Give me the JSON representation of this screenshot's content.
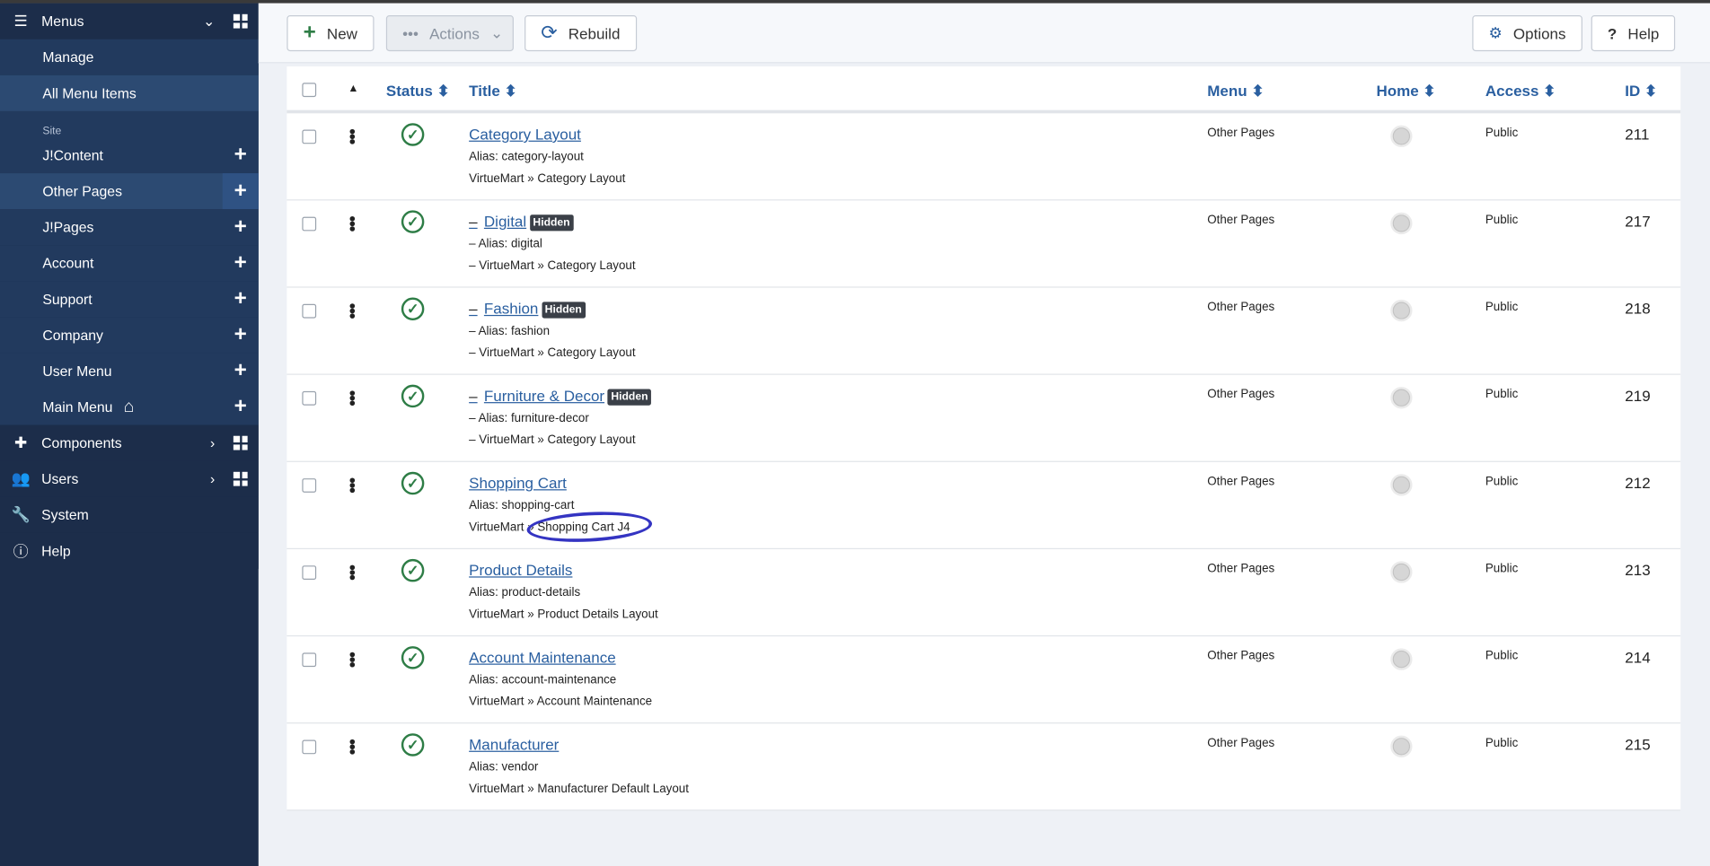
{
  "sidebar": {
    "menus": "Menus",
    "manage": "Manage",
    "all_items": "All Menu Items",
    "site": "Site",
    "menu_items": [
      "J!Content",
      "Other Pages",
      "J!Pages",
      "Account",
      "Support",
      "Company",
      "User Menu",
      "Main Menu"
    ],
    "components": "Components",
    "users": "Users",
    "system": "System",
    "help": "Help"
  },
  "toolbar": {
    "new": "New",
    "actions": "Actions",
    "rebuild": "Rebuild",
    "options": "Options",
    "help": "Help"
  },
  "table": {
    "headers": {
      "status": "Status",
      "title": "Title",
      "menu": "Menu",
      "home": "Home",
      "access": "Access",
      "id": "ID"
    },
    "rows": [
      {
        "title": "Category Layout",
        "alias": "Alias: category-layout",
        "type": "VirtueMart » Category Layout",
        "menu": "Other Pages",
        "access": "Public",
        "id": "211"
      },
      {
        "title": "Digital",
        "badge": "Hidden",
        "alias": "Alias: digital",
        "type": "VirtueMart » Category Layout",
        "menu": "Other Pages",
        "access": "Public",
        "id": "217"
      },
      {
        "title": "Fashion",
        "badge": "Hidden",
        "alias": "Alias: fashion",
        "type": "VirtueMart » Category Layout",
        "menu": "Other Pages",
        "access": "Public",
        "id": "218"
      },
      {
        "title": "Furniture & Decor",
        "badge": "Hidden",
        "alias": "Alias: furniture-decor",
        "type": "VirtueMart » Category Layout",
        "menu": "Other Pages",
        "access": "Public",
        "id": "219"
      },
      {
        "title": "Shopping Cart",
        "alias": "Alias: shopping-cart",
        "type": "VirtueMart » Shopping Cart J4",
        "menu": "Other Pages",
        "access": "Public",
        "id": "212"
      },
      {
        "title": "Product Details",
        "alias": "Alias: product-details",
        "type": "VirtueMart » Product Details Layout",
        "menu": "Other Pages",
        "access": "Public",
        "id": "213"
      },
      {
        "title": "Account Maintenance",
        "alias": "Alias: account-maintenance",
        "type": "VirtueMart » Account Maintenance",
        "menu": "Other Pages",
        "access": "Public",
        "id": "214"
      },
      {
        "title": "Manufacturer",
        "alias": "Alias: vendor",
        "type": "VirtueMart » Manufacturer Default Layout",
        "menu": "Other Pages",
        "access": "Public",
        "id": "215"
      }
    ]
  }
}
